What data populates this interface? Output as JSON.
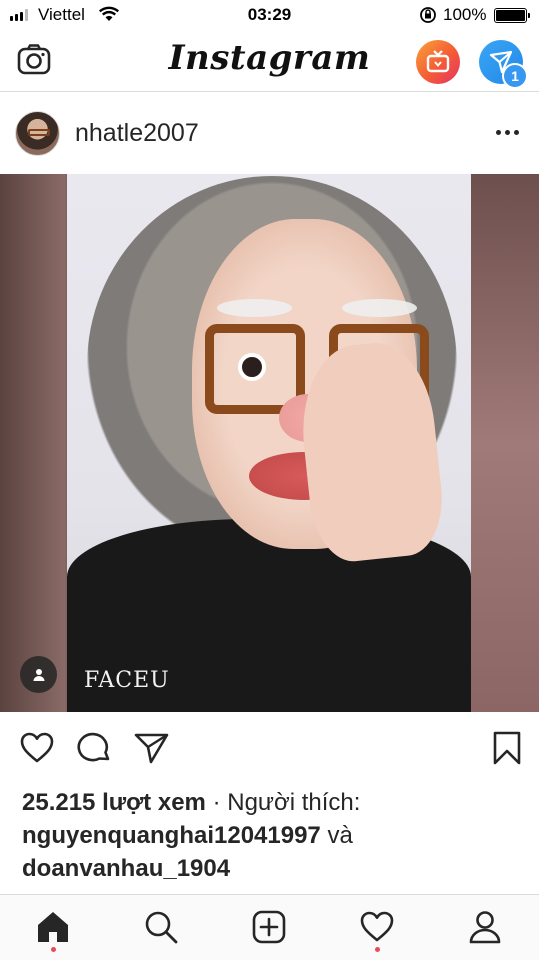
{
  "status_bar": {
    "carrier": "Viettel",
    "time": "03:29",
    "battery_percent": "100%",
    "signal_icon": "cellular-signal-icon",
    "wifi_icon": "wifi-icon",
    "orientation_lock_icon": "orientation-lock-icon",
    "battery_icon": "battery-full-icon"
  },
  "header": {
    "logo_text": "Instagram",
    "camera_icon": "camera-icon",
    "igtv_icon": "igtv-icon",
    "direct_icon": "paper-plane-icon",
    "direct_badge": "1",
    "igtv_color": "#f45b35",
    "direct_color": "#2288e8"
  },
  "post": {
    "username": "nhatle2007",
    "watermark": "FACEU",
    "tag_icon": "user-tag-icon",
    "actions": {
      "like_icon": "heart-icon",
      "comment_icon": "comment-icon",
      "share_icon": "paper-plane-icon",
      "save_icon": "bookmark-icon"
    },
    "views": "25.215 lượt xem",
    "separator": "·",
    "liked_by_label": "Người thích:",
    "liker_1": "nguyenquanghai12041997",
    "and_label": "và",
    "liker_2": "doanvanhau_1904"
  },
  "bottom_nav": {
    "items": [
      {
        "icon": "home-icon",
        "active": true,
        "notification_dot": true
      },
      {
        "icon": "search-icon",
        "active": false,
        "notification_dot": false
      },
      {
        "icon": "add-post-icon",
        "active": false,
        "notification_dot": false
      },
      {
        "icon": "heart-icon",
        "active": false,
        "notification_dot": true
      },
      {
        "icon": "profile-icon",
        "active": false,
        "notification_dot": false
      }
    ],
    "dot_color": "#ed4956"
  }
}
